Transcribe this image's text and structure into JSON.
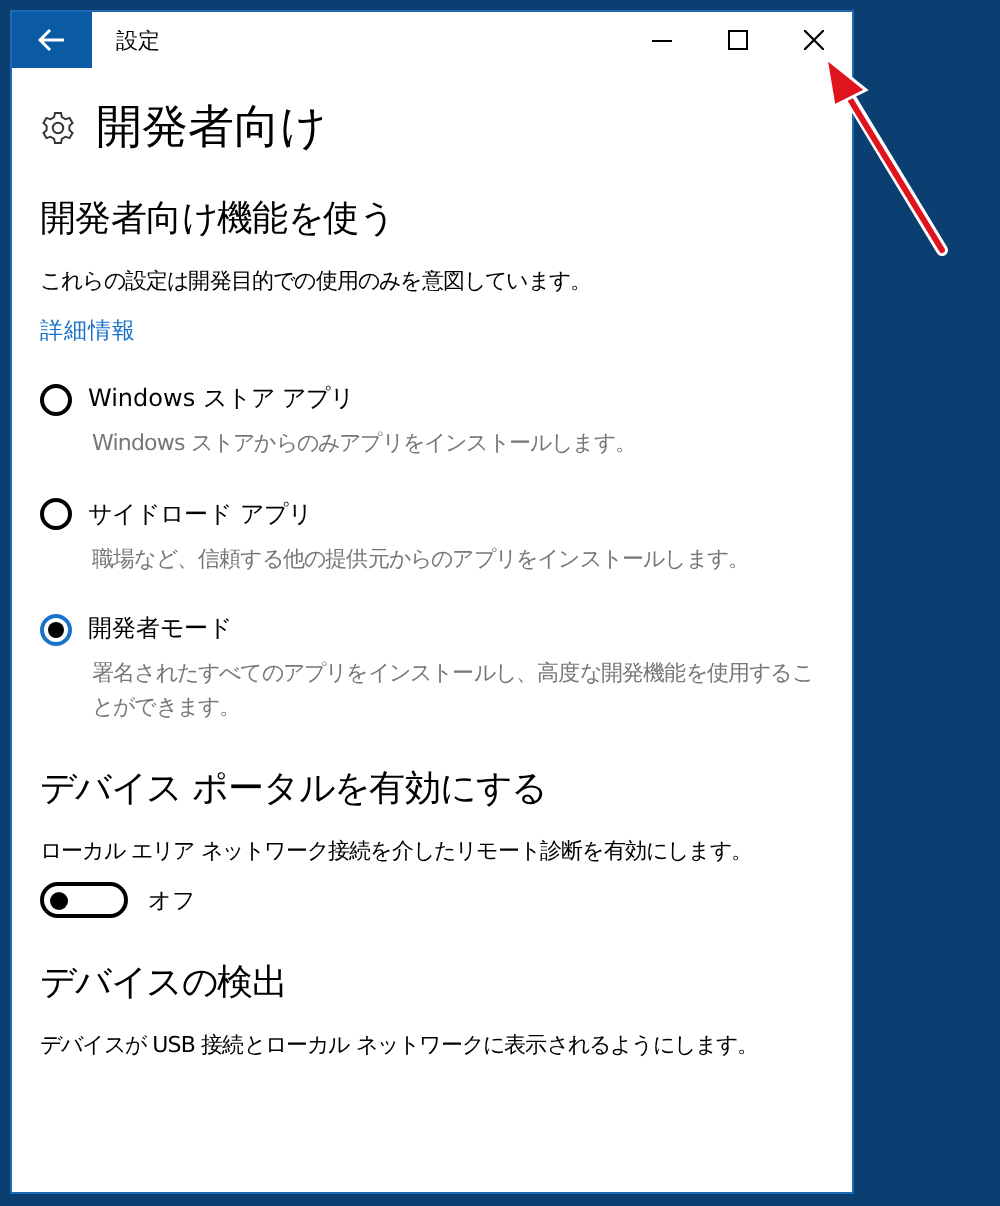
{
  "window": {
    "title": "設定"
  },
  "page": {
    "title": "開発者向け"
  },
  "sections": [
    {
      "heading": "開発者向け機能を使う",
      "description": "これらの設定は開発目的での使用のみを意図しています。",
      "link": "詳細情報",
      "options": [
        {
          "label": "Windows ストア アプリ",
          "description": "Windows ストアからのみアプリをインストールします。",
          "selected": false
        },
        {
          "label": "サイドロード アプリ",
          "description": "職場など、信頼する他の提供元からのアプリをインストールします。",
          "selected": false
        },
        {
          "label": "開発者モード",
          "description": "署名されたすべてのアプリをインストールし、高度な開発機能を使用することができます。",
          "selected": true
        }
      ]
    },
    {
      "heading": "デバイス ポータルを有効にする",
      "description": "ローカル エリア ネットワーク接続を介したリモート診断を有効にします。",
      "toggle": {
        "on": false,
        "label": "オフ"
      }
    },
    {
      "heading": "デバイスの検出",
      "description": "デバイスが USB 接続とローカル ネットワークに表示されるようにします。"
    }
  ]
}
